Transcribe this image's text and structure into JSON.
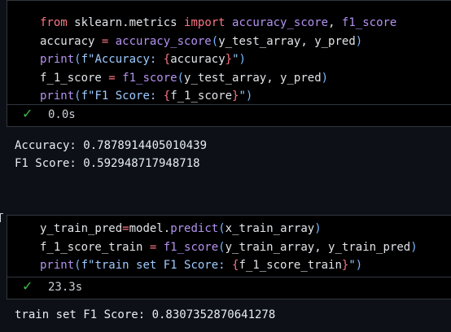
{
  "cell1": {
    "lines": [
      [
        {
          "t": "from",
          "c": "kw"
        },
        {
          "t": " sklearn",
          "c": "id"
        },
        {
          "t": ".",
          "c": "punct"
        },
        {
          "t": "metrics",
          "c": "id"
        },
        {
          "t": " import",
          "c": "kw"
        },
        {
          "t": " accuracy_score",
          "c": "fn"
        },
        {
          "t": ", ",
          "c": "punct"
        },
        {
          "t": "f1_score",
          "c": "fn"
        }
      ],
      [
        {
          "t": "accuracy",
          "c": "id"
        },
        {
          "t": " = ",
          "c": "op"
        },
        {
          "t": "accuracy_score",
          "c": "fn"
        },
        {
          "t": "(",
          "c": "br"
        },
        {
          "t": "y_test_array",
          "c": "id"
        },
        {
          "t": ", ",
          "c": "punct"
        },
        {
          "t": "y_pred",
          "c": "id"
        },
        {
          "t": ")",
          "c": "br"
        }
      ],
      [
        {
          "t": "print",
          "c": "fn"
        },
        {
          "t": "(",
          "c": "br"
        },
        {
          "t": "f\"Accuracy: ",
          "c": "str"
        },
        {
          "t": "{",
          "c": "kw"
        },
        {
          "t": "accuracy",
          "c": "id"
        },
        {
          "t": "}",
          "c": "kw"
        },
        {
          "t": "\"",
          "c": "str"
        },
        {
          "t": ")",
          "c": "br"
        }
      ],
      [
        {
          "t": "f_1_score",
          "c": "id"
        },
        {
          "t": " = ",
          "c": "op"
        },
        {
          "t": "f1_score",
          "c": "fn"
        },
        {
          "t": "(",
          "c": "br"
        },
        {
          "t": "y_test_array",
          "c": "id"
        },
        {
          "t": ", ",
          "c": "punct"
        },
        {
          "t": "y_pred",
          "c": "id"
        },
        {
          "t": ")",
          "c": "br"
        }
      ],
      [
        {
          "t": "print",
          "c": "fn"
        },
        {
          "t": "(",
          "c": "br"
        },
        {
          "t": "f\"F1 Score: ",
          "c": "str"
        },
        {
          "t": "{",
          "c": "kw"
        },
        {
          "t": "f_1_score",
          "c": "id"
        },
        {
          "t": "}",
          "c": "kw"
        },
        {
          "t": "\"",
          "c": "str"
        },
        {
          "t": ")",
          "c": "br"
        }
      ]
    ],
    "status_icon": "check-icon",
    "exec_time": "0.0s",
    "output": "Accuracy: 0.7878914405010439\nF1 Score: 0.592948717948718"
  },
  "cell2": {
    "lines": [
      [
        {
          "t": "y_train_pred",
          "c": "id"
        },
        {
          "t": "=",
          "c": "op"
        },
        {
          "t": "model",
          "c": "id"
        },
        {
          "t": ".",
          "c": "punct"
        },
        {
          "t": "predict",
          "c": "fn"
        },
        {
          "t": "(",
          "c": "br"
        },
        {
          "t": "x_train_array",
          "c": "id"
        },
        {
          "t": ")",
          "c": "br"
        }
      ],
      [
        {
          "t": "f_1_score_train",
          "c": "id"
        },
        {
          "t": " = ",
          "c": "op"
        },
        {
          "t": "f1_score",
          "c": "fn"
        },
        {
          "t": "(",
          "c": "br"
        },
        {
          "t": "y_train_array",
          "c": "id"
        },
        {
          "t": ", ",
          "c": "punct"
        },
        {
          "t": "y_train_pred",
          "c": "id"
        },
        {
          "t": ")",
          "c": "br"
        }
      ],
      [
        {
          "t": "print",
          "c": "fn"
        },
        {
          "t": "(",
          "c": "br"
        },
        {
          "t": "f\"train set F1 Score: ",
          "c": "str"
        },
        {
          "t": "{",
          "c": "kw"
        },
        {
          "t": "f_1_score_train",
          "c": "id"
        },
        {
          "t": "}",
          "c": "kw"
        },
        {
          "t": "\"",
          "c": "str"
        },
        {
          "t": ")",
          "c": "br"
        }
      ]
    ],
    "status_icon": "check-icon",
    "exec_time": "23.3s",
    "output": "train set F1 Score: 0.8307352870641278"
  },
  "colors": {
    "background": "#0d1117",
    "cell_background": "#000000",
    "keyword": "#f97583",
    "function": "#b392f0",
    "string": "#9ecbff",
    "identifier": "#e1e4e8",
    "success": "#3fb950"
  }
}
